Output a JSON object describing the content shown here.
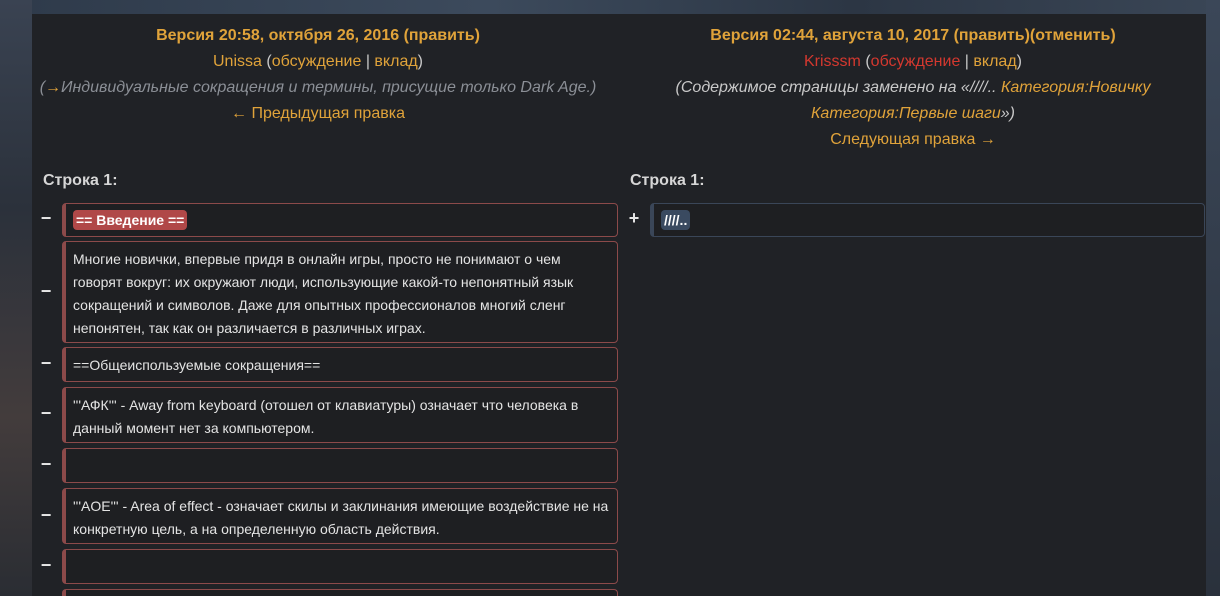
{
  "left": {
    "version_title": "Версия 20:58, октября 26, 2016",
    "edit_link": "править",
    "user": "Unissa",
    "talk_link": "обсуждение",
    "contrib_link": "вклад",
    "summary_arrow": "→",
    "summary_text": "Индивидуальные сокращения и термины, присущие только Dark Age.",
    "prev_link": "← Предыдущая правка",
    "line_label": "Строка 1:"
  },
  "right": {
    "version_title": "Версия 02:44, августа 10, 2017",
    "edit_link": "править",
    "undo_link": "отменить",
    "user": "Krisssm",
    "talk_link": "обсуждение",
    "contrib_link": "вклад",
    "summary_prefix": "Содержимое страницы заменено на «////.. ",
    "summary_cat1": "Категория:Новичку",
    "summary_cat2": "Категория:Первые шаги",
    "summary_suffix": "»",
    "next_link": "Следующая правка →",
    "line_label": "Строка 1:"
  },
  "diff": {
    "minus": "−",
    "plus": "+",
    "removed": [
      "== Введение ==",
      "Многие новички, впервые придя в онлайн игры, просто не понимают о чем говорят вокруг: их окружают люди, использующие какой-то непонятный язык сокращений и символов. Даже для опытных профессионалов многий сленг непонятен, так как он различается в различных играх.",
      "==Общеиспользуемые сокращения==",
      "'''АФК''' - Away from keyboard (отошел от клавиатуры) означает что человека в данный момент нет за компьютером.",
      "",
      "'''AOE''' - Area of effect - означает скилы и заклинания имеющие воздействие не на конкретную цель, а на определенную область действия.",
      "",
      ""
    ],
    "added": "////.."
  }
}
